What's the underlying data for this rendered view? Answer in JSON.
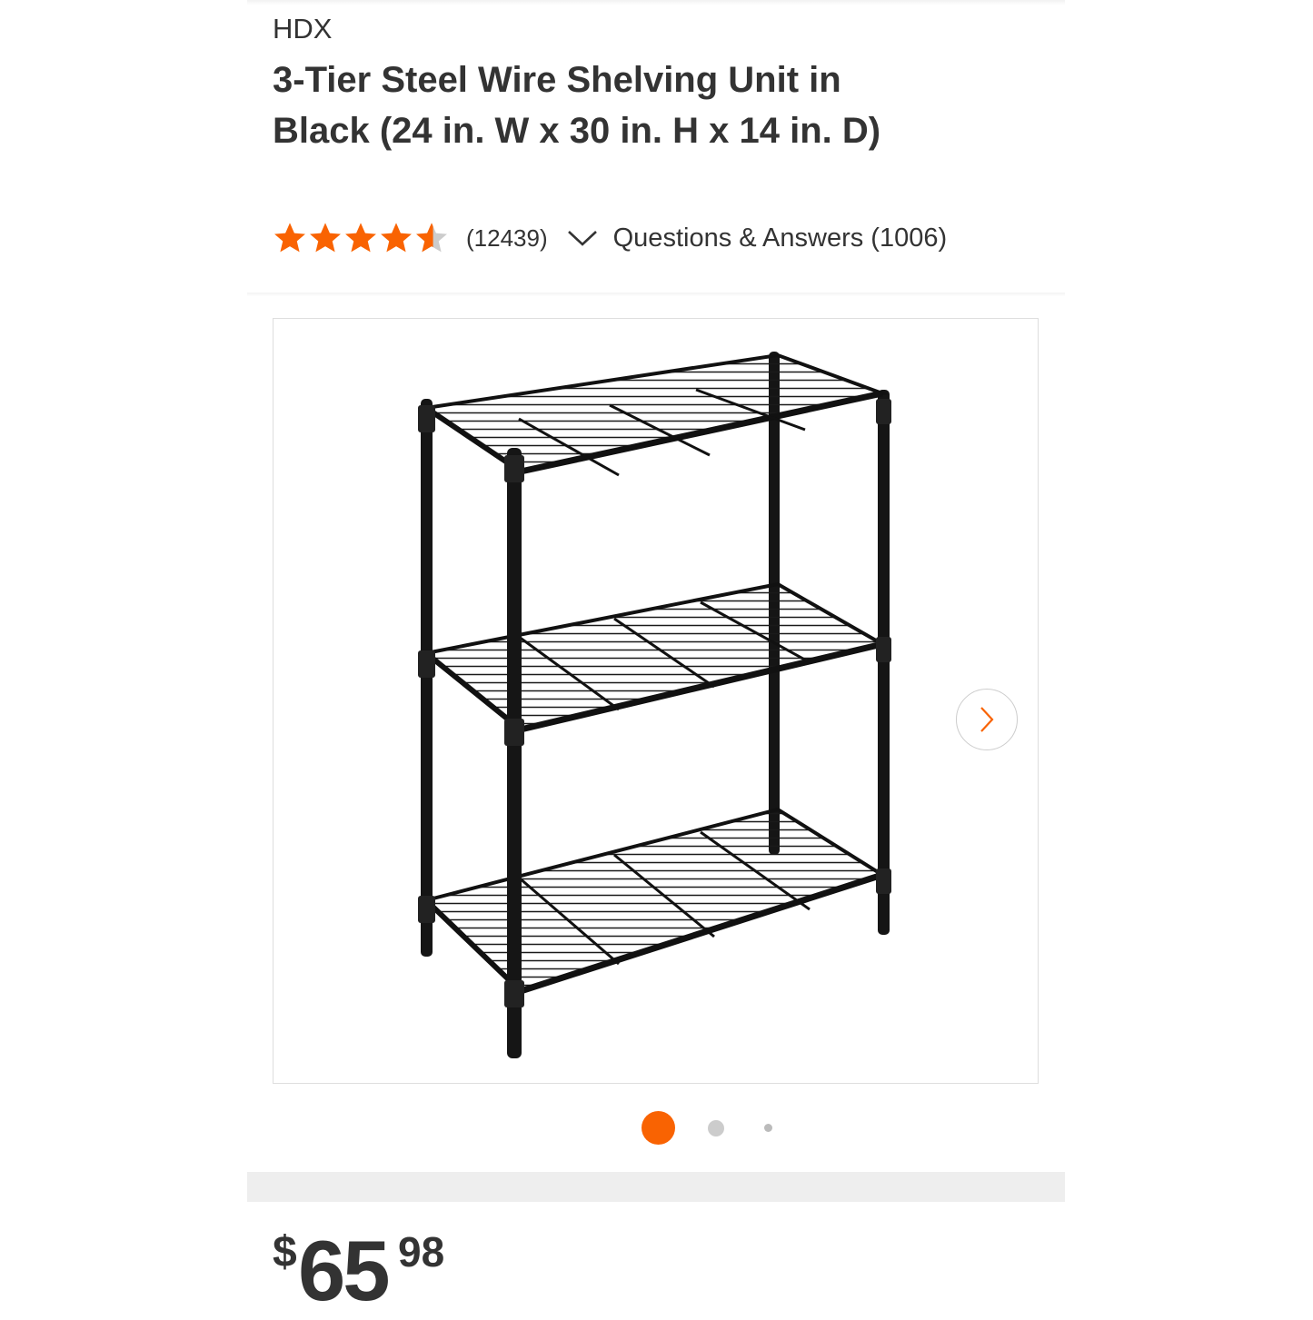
{
  "product": {
    "brand": "HDX",
    "title": "3-Tier Steel Wire Shelving Unit in Black (24 in. W x 30 in. H x 14 in. D)"
  },
  "rating": {
    "stars": 4.5,
    "review_count": "(12439)",
    "qa_label": "Questions & Answers (1006)"
  },
  "gallery": {
    "image_alt": "3-Tier Steel Wire Shelving Unit in Black",
    "current_index": 1,
    "total_images": 3,
    "next_icon": "chevron-right-icon"
  },
  "price": {
    "symbol": "$",
    "dollars": "65",
    "cents": "98"
  },
  "colors": {
    "accent": "#f96302",
    "text": "#333333",
    "star_empty": "#cccccc"
  }
}
